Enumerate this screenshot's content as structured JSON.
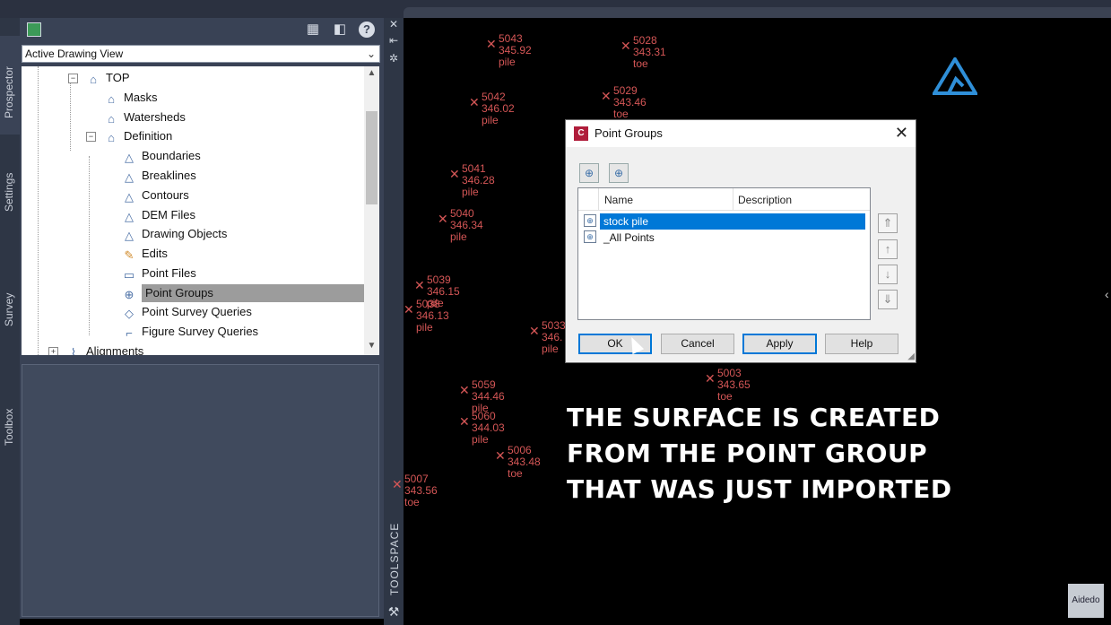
{
  "prospector": {
    "tabs": [
      "Prospector",
      "Settings",
      "Survey",
      "Toolbox"
    ],
    "view_dropdown": "Active Drawing View",
    "tree": [
      {
        "label": "TOP",
        "icon": "surface-icon",
        "expander": "−"
      },
      {
        "label": "Masks",
        "icon": "masks-icon"
      },
      {
        "label": "Watersheds",
        "icon": "watersheds-icon"
      },
      {
        "label": "Definition",
        "icon": "definition-icon",
        "expander": "−"
      },
      {
        "label": "Boundaries",
        "icon": "boundaries-icon"
      },
      {
        "label": "Breaklines",
        "icon": "breaklines-icon"
      },
      {
        "label": "Contours",
        "icon": "contours-icon"
      },
      {
        "label": "DEM Files",
        "icon": "dem-files-icon"
      },
      {
        "label": "Drawing Objects",
        "icon": "drawing-objects-icon"
      },
      {
        "label": "Edits",
        "icon": "edits-icon"
      },
      {
        "label": "Point Files",
        "icon": "point-files-icon"
      },
      {
        "label": "Point Groups",
        "icon": "point-groups-icon",
        "selected": true
      },
      {
        "label": "Point Survey Queries",
        "icon": "point-survey-queries-icon"
      },
      {
        "label": "Figure Survey Queries",
        "icon": "figure-survey-queries-icon"
      },
      {
        "label": "Alignments",
        "icon": "alignments-icon",
        "expander": "+"
      }
    ],
    "toolspace_label": "TOOLSPACE"
  },
  "drawing_points": [
    {
      "num": "5043",
      "elev": "345.92",
      "desc": "pile"
    },
    {
      "num": "5028",
      "elev": "343.31",
      "desc": "toe"
    },
    {
      "num": "5042",
      "elev": "346.02",
      "desc": "pile"
    },
    {
      "num": "5029",
      "elev": "343.46",
      "desc": "toe"
    },
    {
      "num": "5041",
      "elev": "346.28",
      "desc": "pile"
    },
    {
      "num": "5040",
      "elev": "346.34",
      "desc": "pile"
    },
    {
      "num": "5039",
      "elev": "346.15",
      "desc": "pile"
    },
    {
      "num": "5038",
      "elev": "346.13",
      "desc": "pile"
    },
    {
      "num": "5059",
      "elev": "344.46",
      "desc": "pile"
    },
    {
      "num": "5060",
      "elev": "344.03",
      "desc": "pile"
    },
    {
      "num": "5006",
      "elev": "343.48",
      "desc": "toe"
    },
    {
      "num": "5007",
      "elev": "343.56",
      "desc": "toe"
    },
    {
      "num": "5003",
      "elev": "343.65",
      "desc": "toe"
    },
    {
      "num": "5033",
      "elev": "346.",
      "desc": "pile"
    }
  ],
  "dialog": {
    "title": "Point Groups",
    "columns": [
      "Name",
      "Description"
    ],
    "rows": [
      {
        "name": "stock pile",
        "selected": true
      },
      {
        "name": "_All Points"
      }
    ],
    "buttons": {
      "ok": "OK",
      "cancel": "Cancel",
      "apply": "Apply",
      "help": "Help"
    }
  },
  "caption": [
    "THE SURFACE IS CREATED",
    "FROM THE POINT GROUP",
    "THAT WAS JUST IMPORTED"
  ],
  "watermark": "Aidedo"
}
